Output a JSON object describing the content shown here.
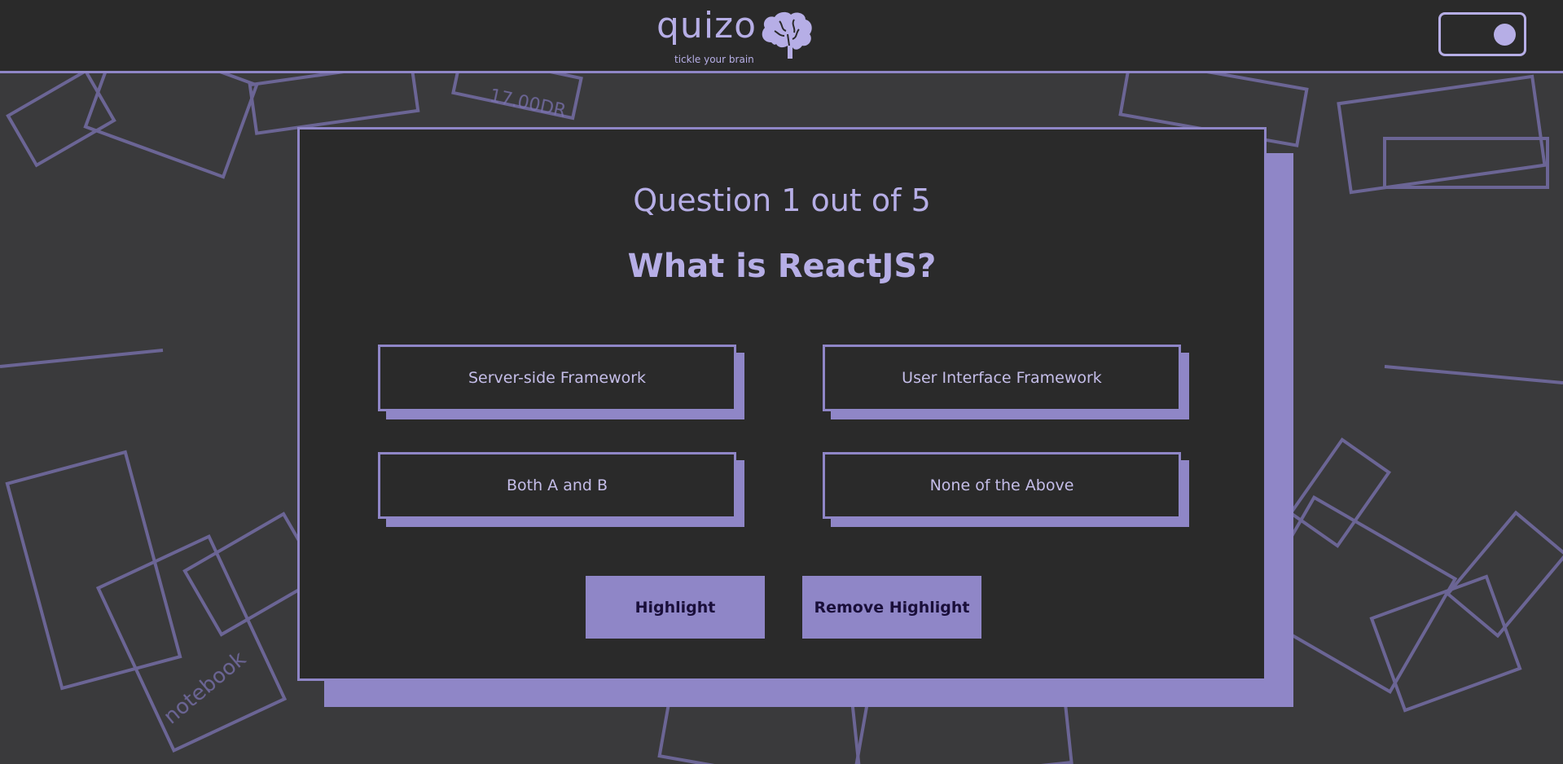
{
  "header": {
    "logo_text": "quizo",
    "tagline": "tickle your brain",
    "logo_icon": "brain-icon",
    "theme_toggle": {
      "state": "on"
    }
  },
  "quiz": {
    "counter": "Question 1 out of 5",
    "question": "What is ReactJS?",
    "options": [
      {
        "label": "Server-side Framework"
      },
      {
        "label": "User Interface Framework"
      },
      {
        "label": "Both A and B"
      },
      {
        "label": "None of the Above"
      }
    ],
    "buttons": {
      "highlight": "Highlight",
      "remove_highlight": "Remove Highlight"
    }
  },
  "colors": {
    "accent": "#8f86c7",
    "accent_text": "#b6aee6",
    "panel": "#2a2a2a",
    "background": "#3a3a3c"
  },
  "background_decoration": {
    "text": [
      "17.00DR",
      "notebook"
    ]
  }
}
